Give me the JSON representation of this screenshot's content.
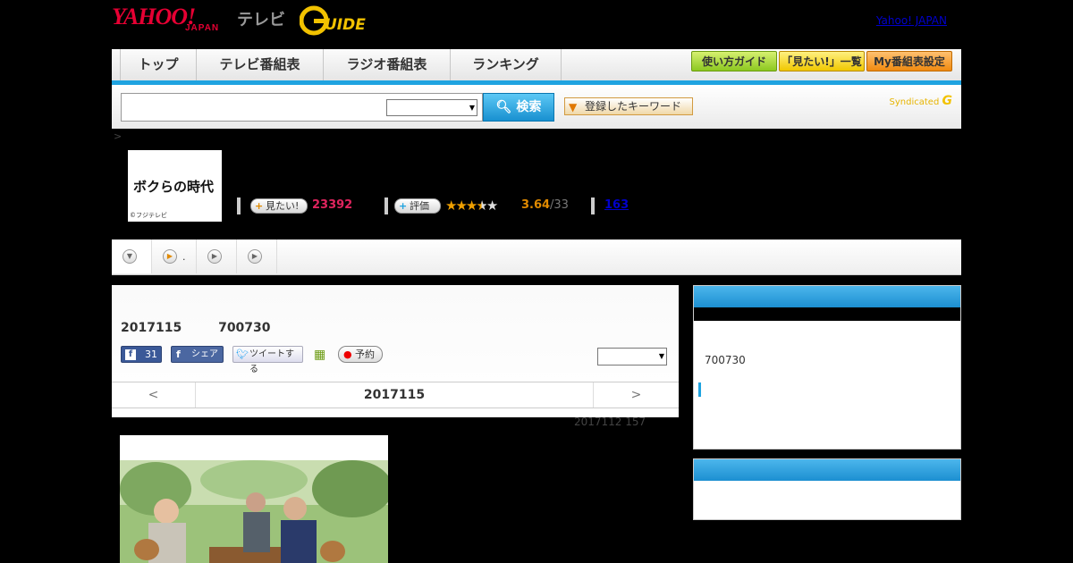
{
  "header": {
    "logo_main": "YAHOO!",
    "logo_sub": "JAPAN",
    "logo_tv": "テレビ",
    "logo_gguide": "G GUIDE",
    "top_link": "Yahoo! JAPAN"
  },
  "nav": {
    "tabs": [
      {
        "label": "トップ"
      },
      {
        "label": "テレビ番組表"
      },
      {
        "label": "ラジオ番組表"
      },
      {
        "label": "ランキング"
      }
    ],
    "buttons": [
      {
        "label": "使い方ガイド"
      },
      {
        "label": "「見たい!」一覧"
      },
      {
        "label": "My番組表設定"
      }
    ]
  },
  "search": {
    "button_label": "検索",
    "keyword_button": "登録したキーワード",
    "syndicated": "Syndicated"
  },
  "breadcrumb": ">",
  "program": {
    "thumb_title": "ボクらの時代",
    "thumb_copyright": "©フジテレビ",
    "mitai_label": "見たい!",
    "mitai_count": "23392",
    "rating_label": "評価",
    "rating_value": "3.64",
    "rating_count": "/33",
    "review_count": "163",
    "rating": 3.64
  },
  "tabs": [
    {
      "label": ""
    },
    {
      "label": "."
    },
    {
      "label": ""
    },
    {
      "label": ""
    }
  ],
  "episode": {
    "date": "2017115",
    "time": "700730",
    "fb_like_count": "31",
    "fb_share": "シェア",
    "tweet": "ツイートする",
    "reserve": "予約",
    "pager_prev": "<",
    "pager_date": "2017115",
    "pager_next": ">",
    "meta": "2017112  157"
  },
  "sidebar": {
    "time": "700730"
  },
  "colors": {
    "accent_blue": "#1fa3e0",
    "yahoo_red": "#e60033",
    "mitai_pink": "#e0245e",
    "rating_orange": "#e08a00"
  }
}
